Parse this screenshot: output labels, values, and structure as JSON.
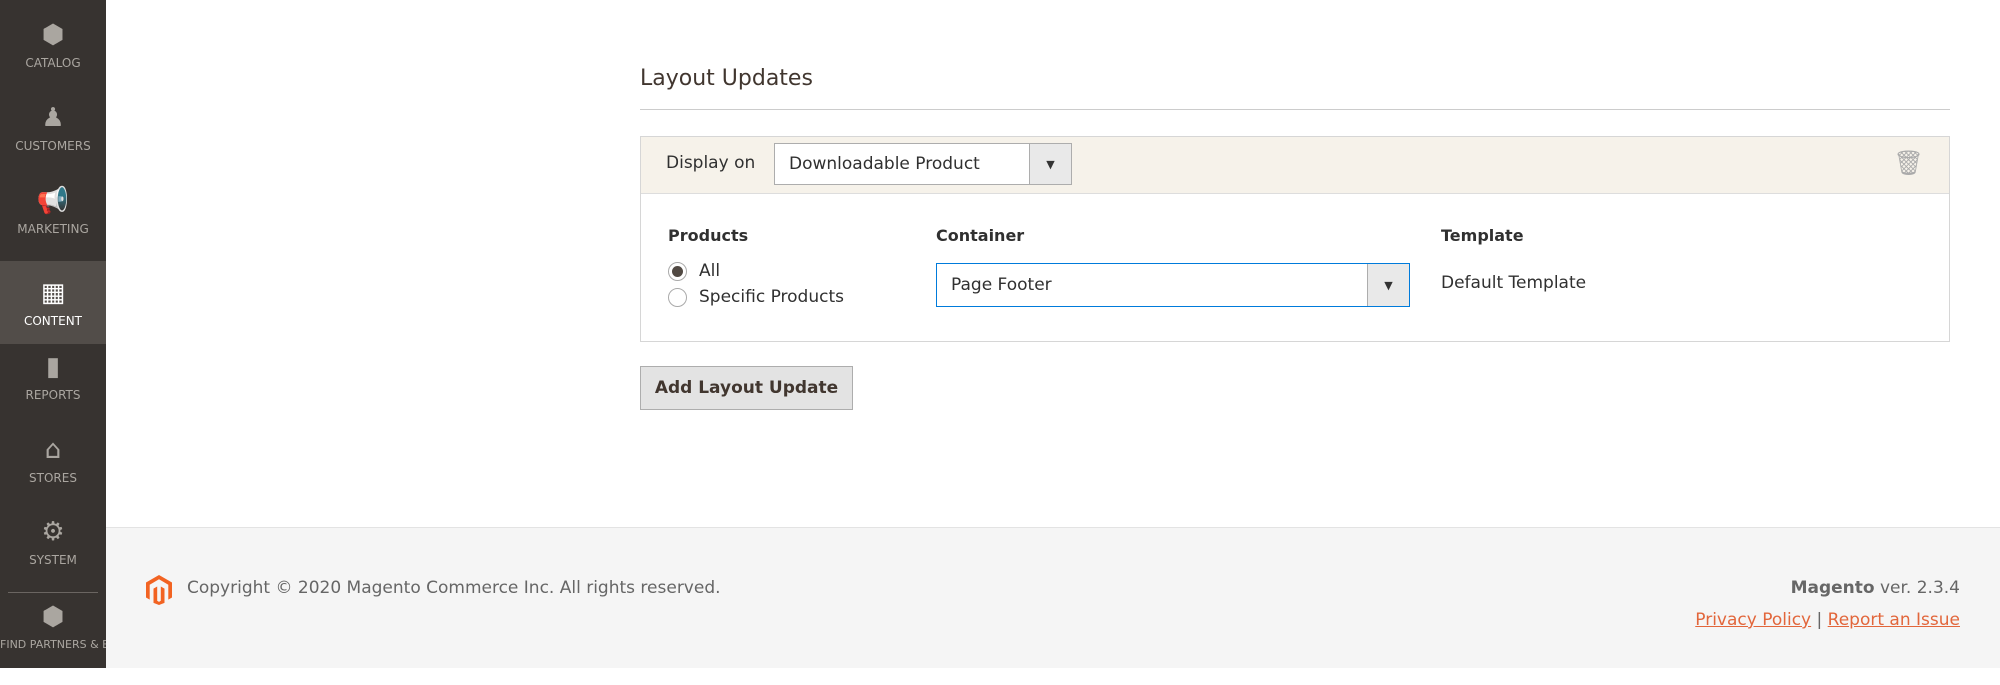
{
  "sidebar": {
    "items": [
      {
        "label": "CATALOG",
        "icon": "box-icon",
        "active": false
      },
      {
        "label": "CUSTOMERS",
        "icon": "person-icon",
        "active": false
      },
      {
        "label": "MARKETING",
        "icon": "megaphone-icon",
        "active": false
      },
      {
        "label": "CONTENT",
        "icon": "layout-icon",
        "active": true
      },
      {
        "label": "REPORTS",
        "icon": "bar-chart-icon",
        "active": false
      },
      {
        "label": "STORES",
        "icon": "store-icon",
        "active": false
      },
      {
        "label": "SYSTEM",
        "icon": "gear-icon",
        "active": false
      },
      {
        "label": "FIND PARTNERS & EXTENSIONS",
        "icon": "blocks-icon",
        "active": false
      }
    ]
  },
  "section": {
    "title": "Layout Updates"
  },
  "layout_update": {
    "display_on_label": "Display on",
    "display_on_value": "Downloadable Product",
    "products_label": "Products",
    "products_options": [
      {
        "label": "All",
        "checked": true
      },
      {
        "label": "Specific Products",
        "checked": false
      }
    ],
    "container_label": "Container",
    "container_value": "Page Footer",
    "template_label": "Template",
    "template_value": "Default Template"
  },
  "add_button": "Add Layout Update",
  "footer": {
    "copyright": "Copyright © 2020 Magento Commerce Inc. All rights reserved.",
    "brand": "Magento",
    "version": "ver. 2.3.4",
    "privacy": "Privacy Policy",
    "separator": "|",
    "report": "Report an Issue"
  },
  "colors": {
    "sidebar": "#373330",
    "active": "#524d49",
    "link": "#e2663b",
    "logo": "#f26322"
  }
}
